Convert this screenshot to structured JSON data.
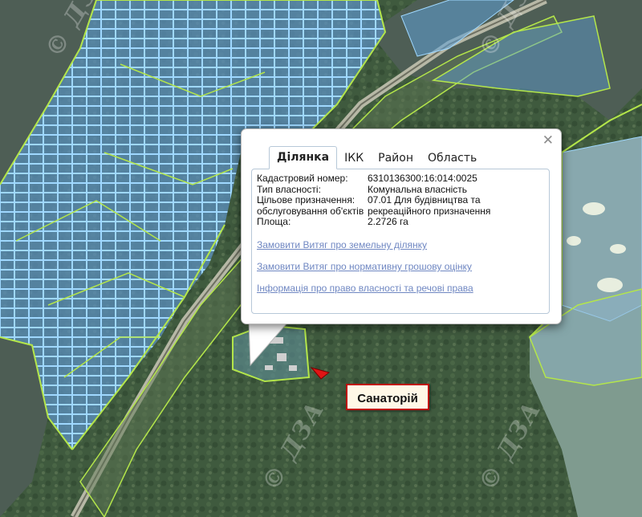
{
  "colors": {
    "parcel_fill": "#5fa0d6",
    "parcel_stroke": "#8fd0f5",
    "boundary": "#b4e64a",
    "water": "#4f5f55",
    "forest": "#3d5a3c",
    "road": "#9a9a8a",
    "golf": "#7e9a8c",
    "label_border": "#c01010",
    "link": "#6f87c2"
  },
  "watermarks": [
    "© ДЗА",
    "© ДЗА",
    "© ДЗА",
    "© ДЗА"
  ],
  "popup": {
    "close_icon": "✕",
    "tabs": [
      "Ділянка",
      "ІКК",
      "Район",
      "Область"
    ],
    "active_tab": "Ділянка",
    "fields": [
      {
        "label": "Кадастровий номер:",
        "value": "6310136300:16:014:0025"
      },
      {
        "label": "Тип власності:",
        "value": "Комунальна власність"
      },
      {
        "label": "Цільове призначення:",
        "value": "07.01 Для будівництва та"
      },
      {
        "label": "обслуговування об'єктів",
        "value": "рекреаційного призначення"
      },
      {
        "label": "Площа:",
        "value": "2.2726 га"
      }
    ],
    "links": [
      "Замовити Витяг про земельну ділянку",
      "Замовити Витяг про нормативну грошову оцінку",
      "Інформація про право власності та речові права"
    ]
  },
  "map_label": {
    "text": "Санаторій",
    "marker_icon": "red-arrow-icon"
  }
}
